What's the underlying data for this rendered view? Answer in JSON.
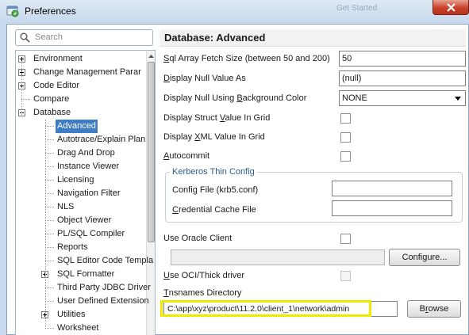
{
  "window": {
    "title": "Preferences",
    "background_text": "Get Started",
    "colors": {
      "accent": "#3e7cc4",
      "highlight": "#f0ea00",
      "group_title": "#2d5b8c"
    }
  },
  "search": {
    "placeholder": "Search"
  },
  "tree": {
    "items": [
      {
        "label": "Environment",
        "expander": "plus"
      },
      {
        "label": "Change Management Parar",
        "expander": "plus"
      },
      {
        "label": "Code Editor",
        "expander": "plus"
      },
      {
        "label": "Compare",
        "expander": "none"
      },
      {
        "label": "Database",
        "expander": "minus"
      },
      {
        "label": "Advanced",
        "selected": true
      },
      {
        "label": "Autotrace/Explain Plan"
      },
      {
        "label": "Drag And Drop"
      },
      {
        "label": "Instance Viewer"
      },
      {
        "label": "Licensing"
      },
      {
        "label": "Navigation Filter"
      },
      {
        "label": "NLS"
      },
      {
        "label": "Object Viewer"
      },
      {
        "label": "PL/SQL Compiler"
      },
      {
        "label": "Reports"
      },
      {
        "label": "SQL Editor Code Templa"
      },
      {
        "label": "SQL Formatter",
        "expander": "plus"
      },
      {
        "label": "Third Party JDBC Driver"
      },
      {
        "label": "User Defined Extension"
      },
      {
        "label": "Utilities",
        "expander": "plus"
      },
      {
        "label": "Worksheet"
      }
    ]
  },
  "panel": {
    "title": "Database: Advanced",
    "fetch_size": {
      "label_pre": "",
      "label_mn": "S",
      "label_post": "ql Array Fetch Size (between 50 and 200)",
      "value": "50"
    },
    "null_value": {
      "label_pre": "",
      "label_mn": "D",
      "label_post": "isplay Null Value As",
      "value": "(null)"
    },
    "null_bg": {
      "label_pre": "Display Null Using ",
      "label_mn": "B",
      "label_post": "ackground Color",
      "value": "NONE"
    },
    "struct_value": {
      "label_pre": "Display Struct ",
      "label_mn": "V",
      "label_post": "alue In Grid",
      "checked": false
    },
    "xml_value": {
      "label_pre": "Display ",
      "label_mn": "X",
      "label_post": "ML Value In Grid",
      "checked": false
    },
    "autocommit": {
      "label_pre": "",
      "label_mn": "A",
      "label_post": "utocommit",
      "checked": false
    },
    "kerberos": {
      "title": "Kerberos Thin Config",
      "config_file": {
        "label_pre": "Confi",
        "label_mn": "g",
        "label_post": " File (krb5.conf)",
        "value": ""
      },
      "cred_cache": {
        "label_pre": "",
        "label_mn": "C",
        "label_post": "redential Cache File",
        "value": ""
      }
    },
    "oracle_client": {
      "label": "Use Oracle Client",
      "checked": false,
      "path_value": "",
      "configure_label": "Configure..."
    },
    "oci": {
      "label_pre": "",
      "label_mn": "U",
      "label_post": "se OCI/Thick driver",
      "checked": false
    },
    "tnsnames": {
      "label_pre": "",
      "label_mn": "T",
      "label_post": "nsnames Directory",
      "value": "C:\\app\\xyz\\product\\11.2.0\\client_1\\network\\admin",
      "browse_pre": "B",
      "browse_mn": "r",
      "browse_post": "owse"
    }
  }
}
